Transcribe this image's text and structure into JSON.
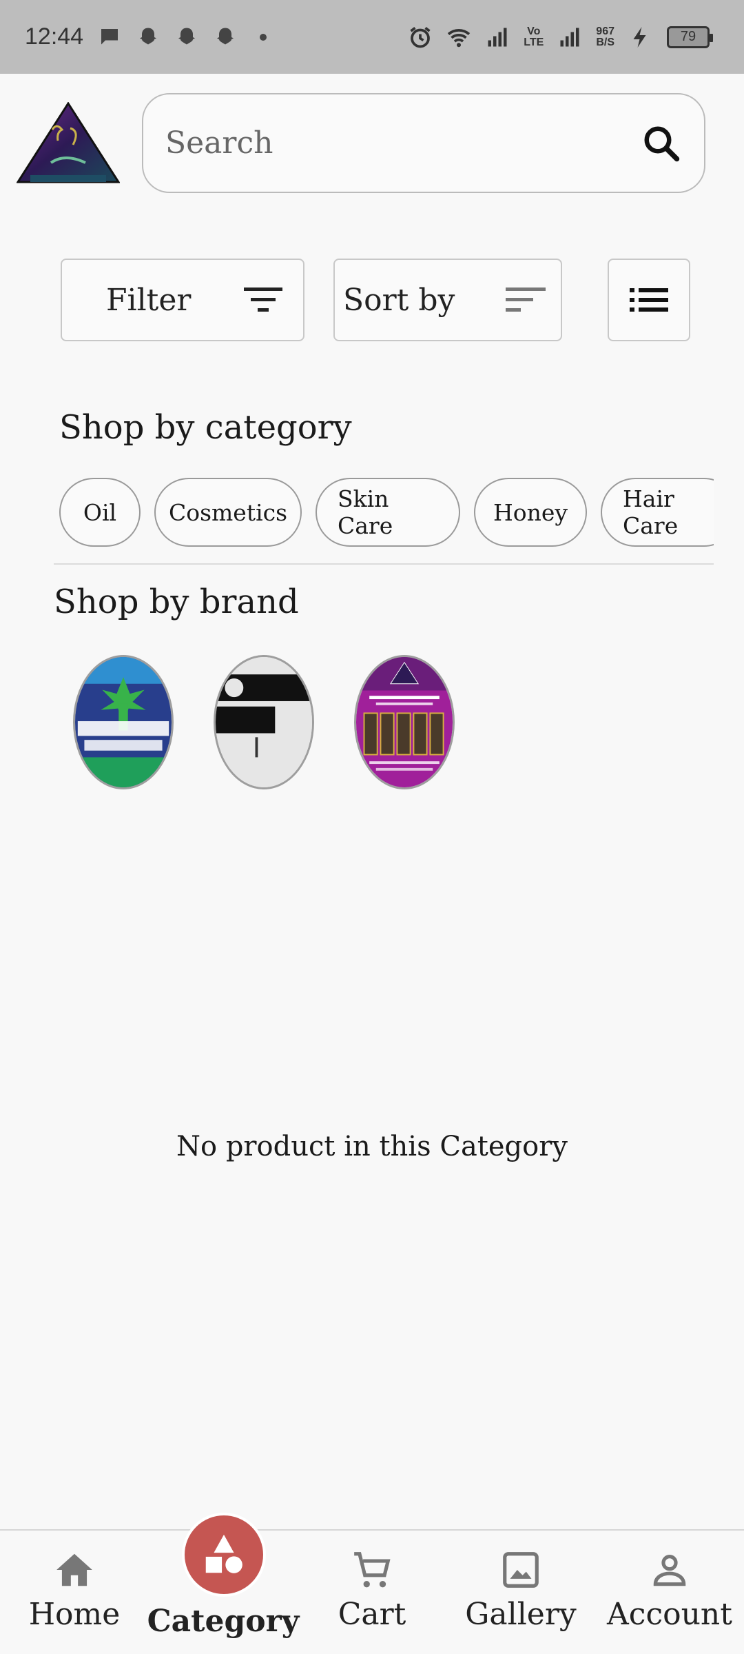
{
  "status_bar": {
    "time": "12:44",
    "network_speed_value": "967",
    "network_speed_unit": "B/S",
    "volte_top": "Vo",
    "volte_bottom": "LTE",
    "battery": "79"
  },
  "search": {
    "placeholder": "Search"
  },
  "controls": {
    "filter_label": "Filter",
    "sort_label": "Sort by"
  },
  "categories": {
    "title": "Shop by category",
    "items": [
      "Oil",
      "Cosmetics",
      "Skin Care",
      "Honey",
      "Hair Care"
    ]
  },
  "brands": {
    "title": "Shop by brand"
  },
  "empty_message": "No product in this Category",
  "nav": {
    "items": [
      "Home",
      "Category",
      "Cart",
      "Gallery",
      "Account"
    ],
    "active": "Category",
    "active_color": "#c55652"
  }
}
